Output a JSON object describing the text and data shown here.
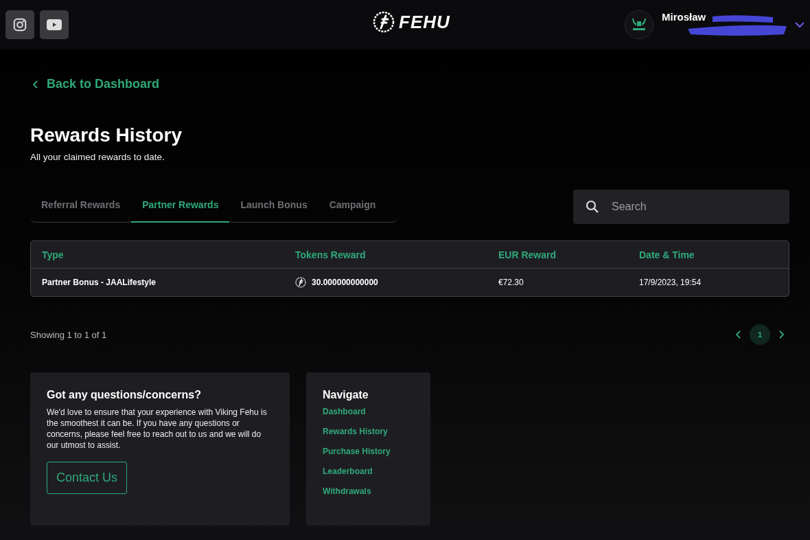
{
  "header": {
    "brand": "FEHU",
    "user": {
      "name": "Mirosław"
    }
  },
  "back_link": "Back to Dashboard",
  "title": "Rewards History",
  "subtitle": "All your claimed rewards to date.",
  "tabs": [
    {
      "label": "Referral Rewards",
      "selected": false
    },
    {
      "label": "Partner Rewards",
      "selected": true
    },
    {
      "label": "Launch Bonus",
      "selected": false
    },
    {
      "label": "Campaign",
      "selected": false
    }
  ],
  "search": {
    "placeholder": "Search"
  },
  "table": {
    "columns": [
      "Type",
      "Tokens Reward",
      "EUR Reward",
      "Date & Time"
    ],
    "rows": [
      {
        "type": "Partner Bonus - JAALifestyle",
        "tokens": "30.000000000000",
        "eur": "€72.30",
        "date": "17/9/2023, 19:54"
      }
    ]
  },
  "showing": "Showing 1 to 1 of 1",
  "pagination": {
    "pages": [
      {
        "label": "1",
        "selected": true
      }
    ]
  },
  "contact_card": {
    "title": "Got any questions/concerns?",
    "text": "We'd love to ensure that your experience with Viking Fehu is the smoothest it can be. If you have any questions or concerns, please feel free to reach out to us and we will do our utmost to assist.",
    "button": "Contact Us"
  },
  "navigate_card": {
    "title": "Navigate",
    "links": [
      "Dashboard",
      "Rewards History",
      "Purchase History",
      "Leaderboard",
      "Withdrawals"
    ]
  }
}
